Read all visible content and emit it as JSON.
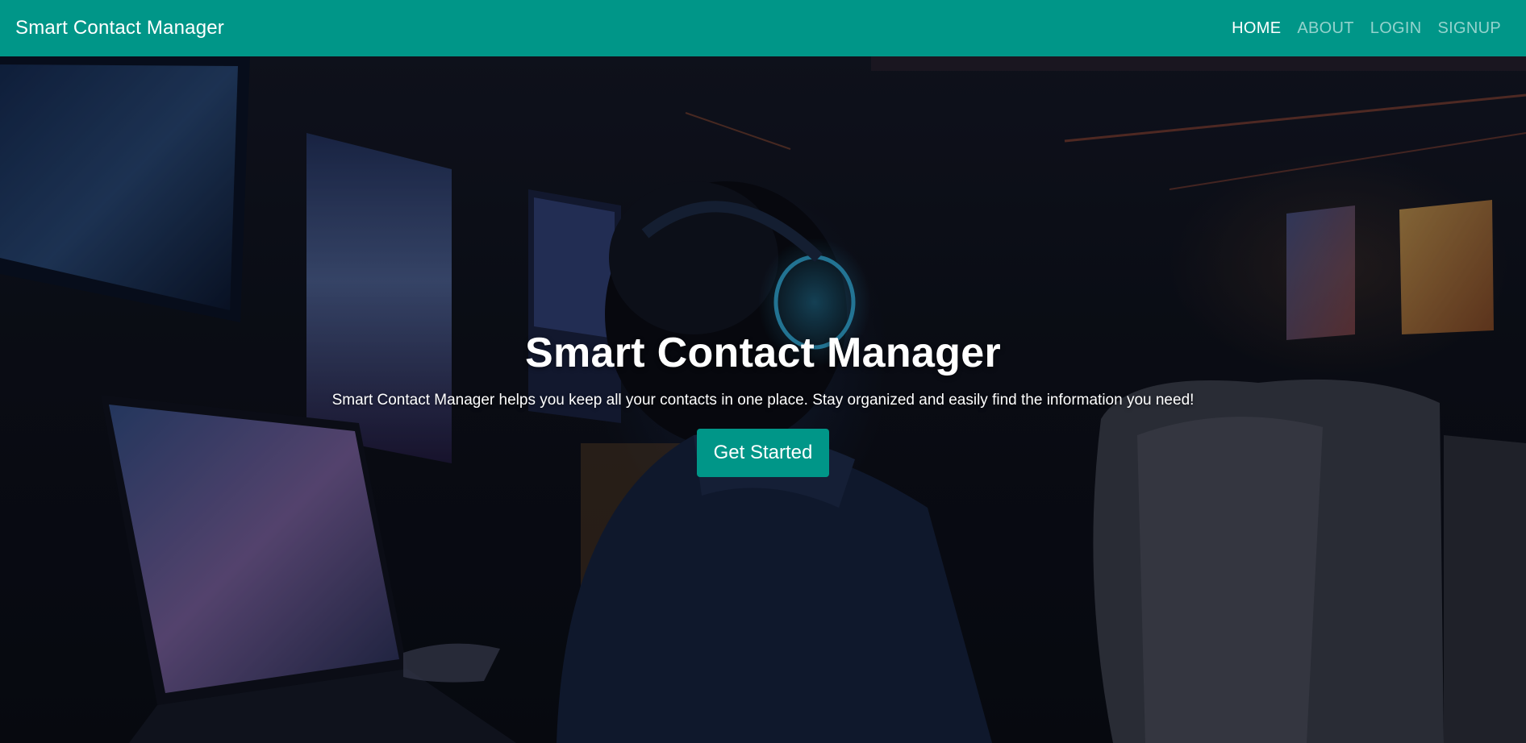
{
  "navbar": {
    "brand": "Smart Contact Manager",
    "links": [
      {
        "label": "HOME",
        "active": true
      },
      {
        "label": "ABOUT",
        "active": false
      },
      {
        "label": "LOGIN",
        "active": false
      },
      {
        "label": "SIGNUP",
        "active": false
      }
    ]
  },
  "hero": {
    "title": "Smart Contact Manager",
    "subtitle": "Smart Contact Manager helps you keep all your contacts in one place. Stay organized and easily find the information you need!",
    "cta_label": "Get Started",
    "background_image": "anime-character-with-headphones-at-computer-illustration"
  },
  "colors": {
    "accent": "#009688",
    "nav_text_active": "#ffffff",
    "nav_text_inactive": "#a6d8d3"
  }
}
